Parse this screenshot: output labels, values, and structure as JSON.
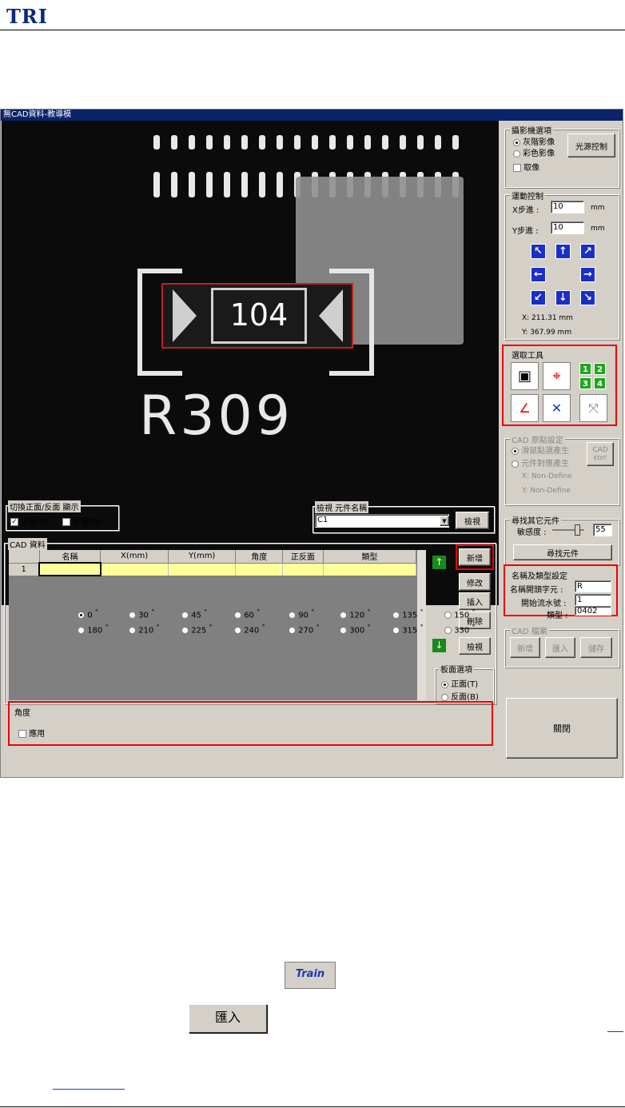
{
  "logo": "TRI",
  "window": {
    "title": "無CAD資料-教導模 "
  },
  "camera": {
    "chip_label": "104",
    "silk_label": "R309"
  },
  "camera_options": {
    "title": "攝影機選項",
    "gray": "灰階影像",
    "color": "彩色影像",
    "light_button": "光源控制",
    "freeze": "取像"
  },
  "motion": {
    "title": "運動控制",
    "x_step_label": "X步進 :",
    "x_step_value": "10",
    "y_step_label": "Y步進 :",
    "y_step_value": "10",
    "unit": "mm",
    "x_pos": "X:   211.31 mm",
    "y_pos": "Y:   367.99 mm"
  },
  "tools": {
    "title": "選取工具",
    "numbers": [
      "1",
      "2",
      "3",
      "4"
    ]
  },
  "cad_origin": {
    "title": "CAD 原點設定",
    "opt1": "滑鼠點選產生",
    "opt2": "元件對應產生",
    "cad_button_line1": "CAD",
    "cad_button_line2": "EDIT",
    "x": "X:    Non-Define",
    "y": "Y:    Non-Define"
  },
  "find_parts": {
    "title": "尋找其它元件",
    "sensitivity_label": "敏感度 :",
    "sensitivity_value": "55",
    "button": "尋找元件"
  },
  "naming": {
    "title": "名稱及類型設定",
    "prefix_label": "名稱開頭字元 :",
    "prefix_value": "R",
    "start_label": "開始流水號 :",
    "start_value": "1",
    "type_label": "類型 :",
    "type_value": "0402"
  },
  "cad_file": {
    "title": "CAD 檔案",
    "new": "新增",
    "import": "匯入",
    "save": "儲存"
  },
  "close_button": "關閉",
  "side_toggle": {
    "title": "切換正面/反面 顯示",
    "front": "正面(T)",
    "back": "反面(B)"
  },
  "part_search": {
    "title": "檢視 元件名稱",
    "value": "C1",
    "button": "檢視"
  },
  "cad_data": {
    "title": "CAD 資料",
    "columns": [
      "名稱",
      "X(mm)",
      "Y(mm)",
      "角度",
      "正反面",
      "類型"
    ],
    "row_number": "1",
    "buttons": {
      "add": "新增",
      "modify": "修改",
      "insert": "插入",
      "delete": "刪除",
      "view": "檢視"
    },
    "board_title": "板面選項",
    "board_front": "正面(T)",
    "board_back": "反面(B)"
  },
  "angle": {
    "title": "角度",
    "apply": "應用",
    "row1": [
      "0",
      "30",
      "45",
      "60",
      "90",
      "120",
      "135",
      "150"
    ],
    "row2": [
      "180",
      "210",
      "225",
      "240",
      "270",
      "300",
      "315",
      "330"
    ],
    "degree": "°"
  },
  "bottom": {
    "train_label": "Train",
    "import_label": "匯入"
  }
}
